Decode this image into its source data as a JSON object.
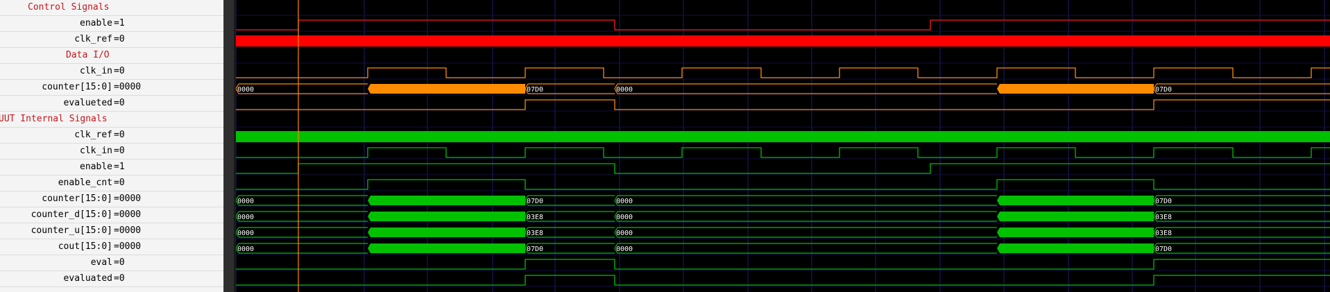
{
  "signals": [
    {
      "kind": "group",
      "label": "Control Signals"
    },
    {
      "kind": "bit",
      "name": "enable",
      "value": "=1",
      "color": "#ff1a1a",
      "wave": "enable"
    },
    {
      "kind": "solid",
      "name": "clk_ref",
      "value": "=0",
      "color": "#ff0000"
    },
    {
      "kind": "group",
      "label": "Data I/O"
    },
    {
      "kind": "bit",
      "name": "clk_in",
      "value": "=0",
      "color": "#ff8c00",
      "wave": "clk"
    },
    {
      "kind": "bus",
      "name": "counter[15:0]",
      "value": "=0000",
      "color": "#ff8c00",
      "labels": [
        "0000",
        "07D0",
        "0000",
        "07D0"
      ]
    },
    {
      "kind": "bit",
      "name": "evalueted",
      "value": "=0",
      "color": "#ff8c00",
      "wave": "eval"
    },
    {
      "kind": "group",
      "label": "UUT Internal Signals"
    },
    {
      "kind": "solid",
      "name": "clk_ref",
      "value": "=0",
      "color": "#00c000"
    },
    {
      "kind": "bit",
      "name": "clk_in",
      "value": "=0",
      "color": "#00c000",
      "wave": "clk"
    },
    {
      "kind": "bit",
      "name": "enable",
      "value": "=1",
      "color": "#00c000",
      "wave": "enable"
    },
    {
      "kind": "bit",
      "name": "enable_cnt",
      "value": "=0",
      "color": "#00c000",
      "wave": "ecnt"
    },
    {
      "kind": "bus",
      "name": "counter[15:0]",
      "value": "=0000",
      "color": "#00c000",
      "labels": [
        "0000",
        "07D0",
        "0000",
        "07D0"
      ]
    },
    {
      "kind": "bus",
      "name": "counter_d[15:0]",
      "value": "=0000",
      "color": "#00c000",
      "labels": [
        "0000",
        "03E8",
        "0000",
        "03E8"
      ]
    },
    {
      "kind": "bus",
      "name": "counter_u[15:0]",
      "value": "=0000",
      "color": "#00c000",
      "labels": [
        "0000",
        "03E8",
        "0000",
        "03E8"
      ]
    },
    {
      "kind": "bus",
      "name": "cout[15:0]",
      "value": "=0000",
      "color": "#00c000",
      "labels": [
        "0000",
        "07D0",
        "0000",
        "07D0"
      ]
    },
    {
      "kind": "bit",
      "name": "eval",
      "value": "=0",
      "color": "#00c000",
      "wave": "eval"
    },
    {
      "kind": "bit",
      "name": "evaluated",
      "value": "=0",
      "color": "#00c000",
      "wave": "eval"
    }
  ],
  "colors": {
    "group_label": "#c4161c",
    "grid": "#1c1c6e",
    "cursor": "#ff8c00",
    "background": "#000000"
  }
}
